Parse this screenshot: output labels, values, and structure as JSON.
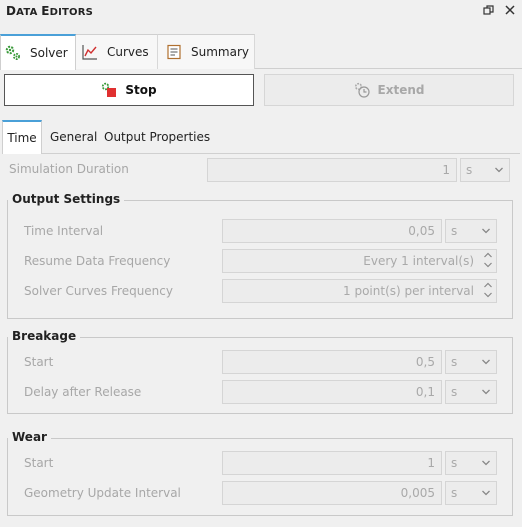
{
  "panel": {
    "title_first": "D",
    "title_rest": "ATA ",
    "title_second_first": "E",
    "title_second_rest": "DITORS",
    "restore_icon": "restore-window-icon",
    "close_icon": "close-icon"
  },
  "top_tabs": [
    {
      "label": "Solver",
      "icon": "gears-icon",
      "active": true
    },
    {
      "label": "Curves",
      "icon": "line-chart-icon",
      "active": false
    },
    {
      "label": "Summary",
      "icon": "document-list-icon",
      "active": false
    }
  ],
  "actions": {
    "stop_label": "Stop",
    "extend_label": "Extend"
  },
  "sub_tabs": [
    {
      "label": "Time",
      "active": true
    },
    {
      "label": "General",
      "active": false
    },
    {
      "label": "Output Properties",
      "active": false
    }
  ],
  "simulation": {
    "label": "Simulation Duration",
    "value": "1",
    "unit": "s"
  },
  "output_settings": {
    "title": "Output Settings",
    "time_interval": {
      "label": "Time Interval",
      "value": "0,05",
      "unit": "s"
    },
    "resume_frequency": {
      "label": "Resume Data Frequency",
      "value": "Every 1 interval(s)"
    },
    "curves_frequency": {
      "label": "Solver Curves Frequency",
      "value": "1 point(s) per interval"
    }
  },
  "breakage": {
    "title": "Breakage",
    "start": {
      "label": "Start",
      "value": "0,5",
      "unit": "s"
    },
    "delay": {
      "label": "Delay after Release",
      "value": "0,1",
      "unit": "s"
    }
  },
  "wear": {
    "title": "Wear",
    "start": {
      "label": "Start",
      "value": "1",
      "unit": "s"
    },
    "geometry_interval": {
      "label": "Geometry Update Interval",
      "value": "0,005",
      "unit": "s"
    }
  },
  "colors": {
    "accent": "#4aa0d8",
    "stop_red": "#e03030",
    "icon_green": "#3a9a3a"
  }
}
